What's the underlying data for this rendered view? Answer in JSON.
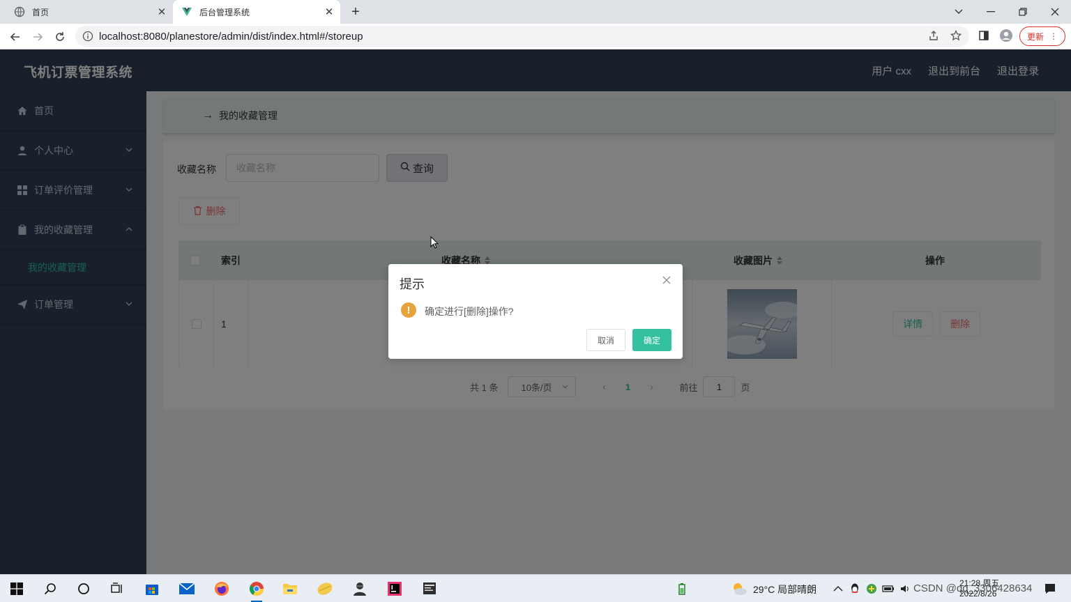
{
  "browser": {
    "tabs": [
      {
        "title": "首页"
      },
      {
        "title": "后台管理系统"
      }
    ],
    "url": "localhost:8080/planestore/admin/dist/index.html#/storeup",
    "update_label": "更新"
  },
  "app": {
    "title": "飞机订票管理系统",
    "header_links": {
      "user": "用户 cxx",
      "front": "退出到前台",
      "logout": "退出登录"
    }
  },
  "sidebar": {
    "items": [
      {
        "label": "首页"
      },
      {
        "label": "个人中心"
      },
      {
        "label": "订单评价管理"
      },
      {
        "label": "我的收藏管理"
      },
      {
        "label": "订单管理"
      }
    ],
    "submenu": {
      "label": "我的收藏管理"
    }
  },
  "breadcrumb": {
    "label": "我的收藏管理"
  },
  "search": {
    "label": "收藏名称",
    "placeholder": "收藏名称",
    "button": "查询"
  },
  "actions": {
    "delete": "删除"
  },
  "table": {
    "headers": [
      "索引",
      "收藏名称",
      "收藏图片",
      "操作"
    ],
    "rows": [
      {
        "index": "1",
        "name": "",
        "detail": "详情",
        "delete": "删除"
      }
    ]
  },
  "pagination": {
    "total": "共 1 条",
    "page_size": "10条/页",
    "current": "1",
    "goto": "前往",
    "goto_value": "1",
    "page_unit": "页"
  },
  "dialog": {
    "title": "提示",
    "message": "确定进行[删除]操作?",
    "cancel": "取消",
    "confirm": "确定"
  },
  "taskbar": {
    "weather": "29°C 局部晴朗",
    "time": "21:28 周五",
    "date": "2022/8/26",
    "watermark": "CSDN @qq_3306428634"
  },
  "colors": {
    "accent": "#33c1a0",
    "sidebar_bg": "#304156",
    "danger": "#f56c6c",
    "warning": "#e6a23c"
  }
}
